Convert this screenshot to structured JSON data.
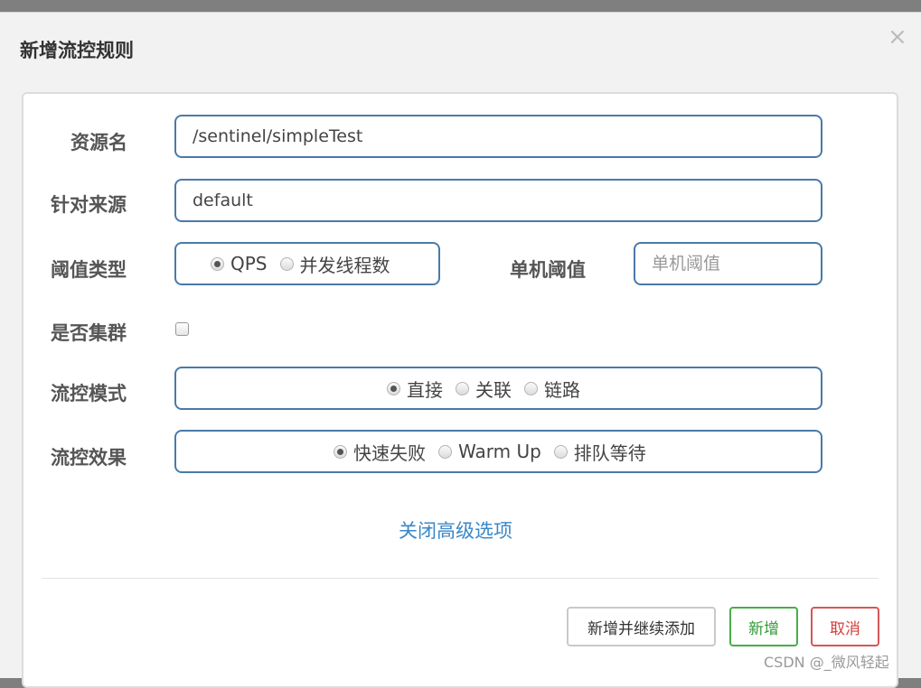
{
  "dialog": {
    "title": "新增流控规则",
    "close": "×"
  },
  "form": {
    "resource_label": "资源名",
    "resource_value": "/sentinel/simpleTest",
    "source_label": "针对来源",
    "source_value": "default",
    "threshold_type_label": "阈值类型",
    "threshold_type_options": [
      "QPS",
      "并发线程数"
    ],
    "threshold_type_selected": "QPS",
    "threshold_label": "单机阈值",
    "threshold_placeholder": "单机阈值",
    "threshold_value": "",
    "cluster_label": "是否集群",
    "cluster_checked": false,
    "mode_label": "流控模式",
    "mode_options": [
      "直接",
      "关联",
      "链路"
    ],
    "mode_selected": "直接",
    "effect_label": "流控效果",
    "effect_options": [
      "快速失败",
      "Warm Up",
      "排队等待"
    ],
    "effect_selected": "快速失败",
    "advanced_link": "关闭高级选项"
  },
  "footer": {
    "add_continue_label": "新增并继续添加",
    "add_label": "新增",
    "cancel_label": "取消"
  },
  "watermark": "CSDN @_微风轻起",
  "colors": {
    "input_border": "#4a7aa8",
    "link": "#3a87c7",
    "success": "#48ad4a",
    "danger": "#d65656"
  }
}
